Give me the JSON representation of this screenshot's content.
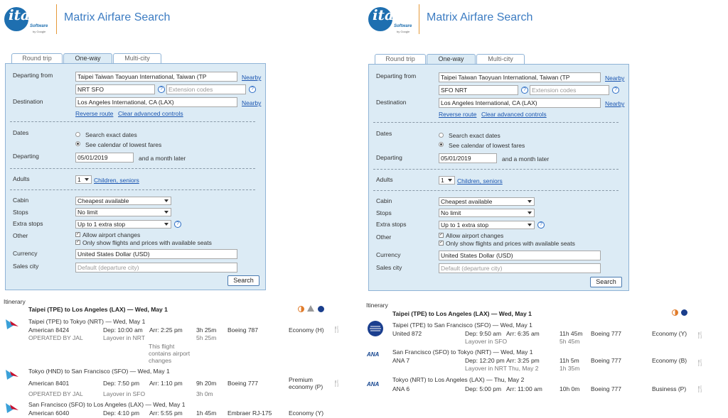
{
  "app": {
    "title": "Matrix Airfare Search",
    "logo_text": "ita",
    "logo_sub": "Software",
    "logo_by": "by Google"
  },
  "tabs": [
    "Round trip",
    "One-way",
    "Multi-city"
  ],
  "labels": {
    "departing_from": "Departing from",
    "destination": "Destination",
    "dates": "Dates",
    "departing": "Departing",
    "adults": "Adults",
    "cabin": "Cabin",
    "stops": "Stops",
    "extra_stops": "Extra stops",
    "other": "Other",
    "currency": "Currency",
    "sales_city": "Sales city",
    "nearby": "Nearby",
    "reverse_route": "Reverse route",
    "clear_advanced": "Clear advanced controls",
    "search_exact": "Search exact dates",
    "see_calendar": "See calendar of lowest fares",
    "month_later": "and a month later",
    "children": "Children, seniors",
    "allow_airport": "Allow airport changes",
    "only_show": "Only show flights and prices with available seats",
    "search_button": "Search",
    "itinerary": "Itinerary",
    "ext_codes_placeholder": "Extension codes",
    "sales_city_placeholder": "Default (departure city)"
  },
  "form_values": {
    "origin": "Taipei Taiwan Taoyuan International, Taiwan (TP",
    "destination": "Los Angeles International, CA (LAX)",
    "departing_date": "05/01/2019",
    "adults": "1",
    "cabin": "Cheapest available",
    "stops": "No limit",
    "extra_stops": "Up to 1 extra stop",
    "currency": "United States Dollar (USD)"
  },
  "left": {
    "routing": "NRT SFO",
    "itinerary_title": "Taipei (TPE) to Los Angeles (LAX) — Wed, May 1",
    "flights": [
      {
        "route": "Taipei (TPE) to Tokyo (NRT) — Wed, May 1",
        "flight": "American 8424",
        "dep": "Dep: 10:00 am",
        "arr": "Arr: 2:25 pm",
        "dur": "3h 25m",
        "aircraft": "Boeing 787",
        "cabin": "Economy (H)",
        "operated": "OPERATED BY JAL",
        "layover": "Layover in NRT",
        "layover_dur": "5h 25m",
        "note": "This flight contains airport changes"
      },
      {
        "route": "Tokyo (HND) to San Francisco (SFO) — Wed, May 1",
        "flight": "American 8401",
        "dep": "Dep: 7:50 pm",
        "arr": "Arr: 1:10 pm",
        "dur": "9h 20m",
        "aircraft": "Boeing 777",
        "cabin": "Premium economy (P)",
        "operated": "OPERATED BY JAL",
        "layover": "Layover in SFO",
        "layover_dur": "3h 0m"
      },
      {
        "route": "San Francisco (SFO) to Los Angeles (LAX) — Wed, May 1",
        "flight": "American 6040",
        "dep": "Dep: 4:10 pm",
        "arr": "Arr: 5:55 pm",
        "dur": "1h 45m",
        "aircraft": "Embraer RJ-175",
        "cabin": "Economy (Y)"
      }
    ]
  },
  "right": {
    "routing": "SFO NRT",
    "itinerary_title": "Taipei (TPE) to Los Angeles (LAX) — Wed, May 1",
    "flights": [
      {
        "route": "Taipei (TPE) to San Francisco (SFO) — Wed, May 1",
        "flight": "United 872",
        "dep": "Dep: 9:50 am",
        "arr": "Arr: 6:35 am",
        "dur": "11h 45m",
        "aircraft": "Boeing 777",
        "cabin": "Economy (Y)",
        "layover": "Layover in SFO",
        "layover_dur": "5h 45m"
      },
      {
        "route": "San Francisco (SFO) to Tokyo (NRT) — Wed, May 1",
        "flight": "ANA 7",
        "dep": "Dep: 12:20 pm",
        "arr": "Arr: 3:25 pm",
        "dur": "11h 5m",
        "aircraft": "Boeing 777",
        "cabin": "Economy (B)",
        "layover": "Layover in NRT Thu, May 2",
        "layover_dur": "1h 35m"
      },
      {
        "route": "Tokyo (NRT) to Los Angeles (LAX) — Thu, May 2",
        "flight": "ANA 6",
        "dep": "Dep: 5:00 pm",
        "arr": "Arr: 11:00 am",
        "dur": "10h 0m",
        "aircraft": "Boeing 777",
        "cabin": "Business (P)"
      }
    ]
  }
}
